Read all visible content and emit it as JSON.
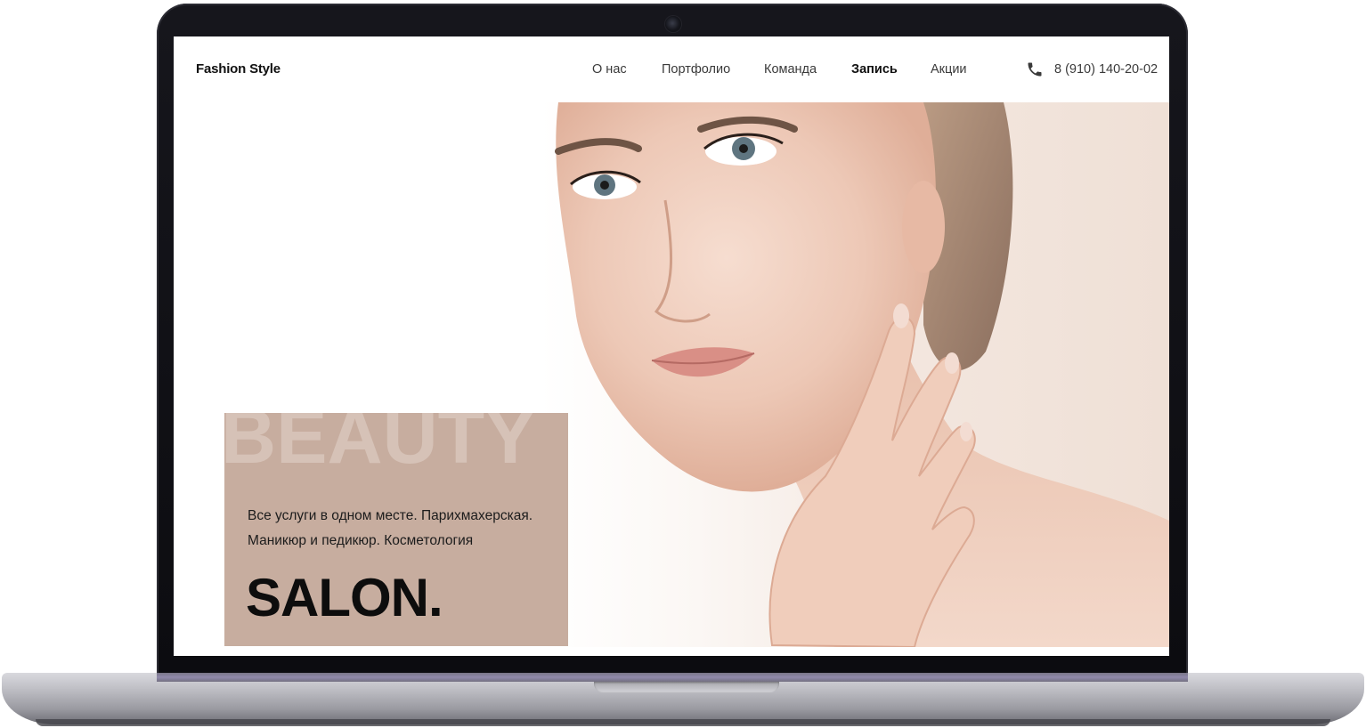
{
  "header": {
    "logo": "Fashion Style",
    "nav": [
      {
        "label": "О нас",
        "active": false
      },
      {
        "label": "Портфолио",
        "active": false
      },
      {
        "label": "Команда",
        "active": false
      },
      {
        "label": "Запись",
        "active": true
      },
      {
        "label": "Акции",
        "active": false
      }
    ],
    "phone_icon": "phone-icon",
    "phone": "8 (910) 140-20-02"
  },
  "hero": {
    "watermark": "BEAUTY",
    "tagline_line1": "Все услуги в одном месте. Парихмахерская.",
    "tagline_line2": "Маникюр и педикюр. Косметология",
    "title": "SALON.",
    "box_color": "#c7ad9f"
  }
}
